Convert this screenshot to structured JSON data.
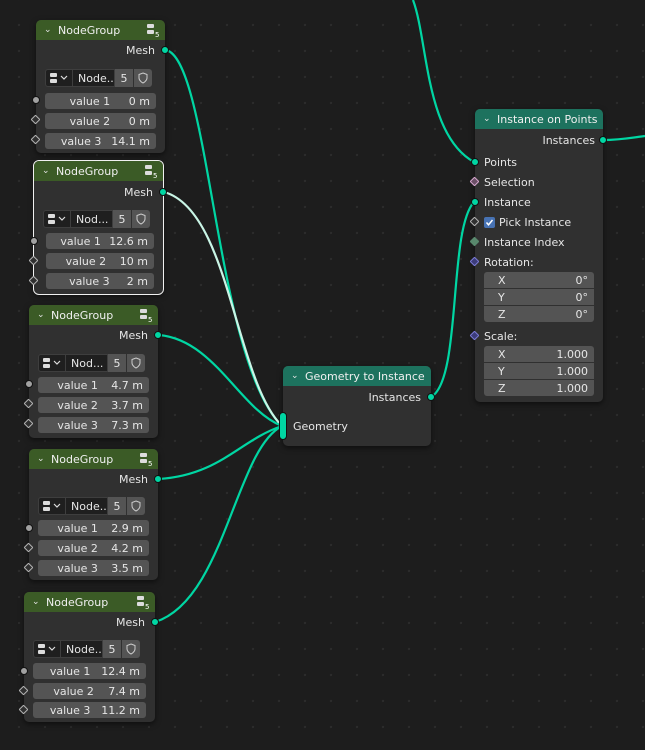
{
  "node_groups": [
    {
      "title": "NodeGroup",
      "output": "Mesh",
      "datablock": "Node...",
      "users": "5",
      "values": [
        {
          "label": "value 1",
          "value": "0 m"
        },
        {
          "label": "value 2",
          "value": "0 m"
        },
        {
          "label": "value 3",
          "value": "14.1 m"
        }
      ]
    },
    {
      "title": "NodeGroup",
      "output": "Mesh",
      "datablock": "Nod...",
      "users": "5",
      "values": [
        {
          "label": "value 1",
          "value": "12.6 m"
        },
        {
          "label": "value 2",
          "value": "10 m"
        },
        {
          "label": "value 3",
          "value": "2 m"
        }
      ]
    },
    {
      "title": "NodeGroup",
      "output": "Mesh",
      "datablock": "Nod...",
      "users": "5",
      "values": [
        {
          "label": "value 1",
          "value": "4.7 m"
        },
        {
          "label": "value 2",
          "value": "3.7 m"
        },
        {
          "label": "value 3",
          "value": "7.3 m"
        }
      ]
    },
    {
      "title": "NodeGroup",
      "output": "Mesh",
      "datablock": "Node...",
      "users": "5",
      "values": [
        {
          "label": "value 1",
          "value": "2.9 m"
        },
        {
          "label": "value 2",
          "value": "4.2 m"
        },
        {
          "label": "value 3",
          "value": "3.5 m"
        }
      ]
    },
    {
      "title": "NodeGroup",
      "output": "Mesh",
      "datablock": "Node...",
      "users": "5",
      "values": [
        {
          "label": "value 1",
          "value": "12.4 m"
        },
        {
          "label": "value 2",
          "value": "7.4 m"
        },
        {
          "label": "value 3",
          "value": "11.2 m"
        }
      ]
    }
  ],
  "header_badge": "5",
  "geometry_to_instance": {
    "title": "Geometry to Instance",
    "output": "Instances",
    "input": "Geometry"
  },
  "instance_on_points": {
    "title": "Instance on Points",
    "output": "Instances",
    "inputs": {
      "points": "Points",
      "selection": "Selection",
      "instance": "Instance",
      "pick_instance": "Pick Instance",
      "instance_index": "Instance Index",
      "rotation": "Rotation:",
      "scale": "Scale:"
    },
    "rotation": [
      {
        "axis": "X",
        "value": "0°"
      },
      {
        "axis": "Y",
        "value": "0°"
      },
      {
        "axis": "Z",
        "value": "0°"
      }
    ],
    "scale": [
      {
        "axis": "X",
        "value": "1.000"
      },
      {
        "axis": "Y",
        "value": "1.000"
      },
      {
        "axis": "Z",
        "value": "1.000"
      }
    ]
  },
  "colors": {
    "geometry_socket": "#00d6a3",
    "group_header": "#3b5b26",
    "geometry_header": "#1d725e",
    "selected_link": "#c9f5e6"
  }
}
